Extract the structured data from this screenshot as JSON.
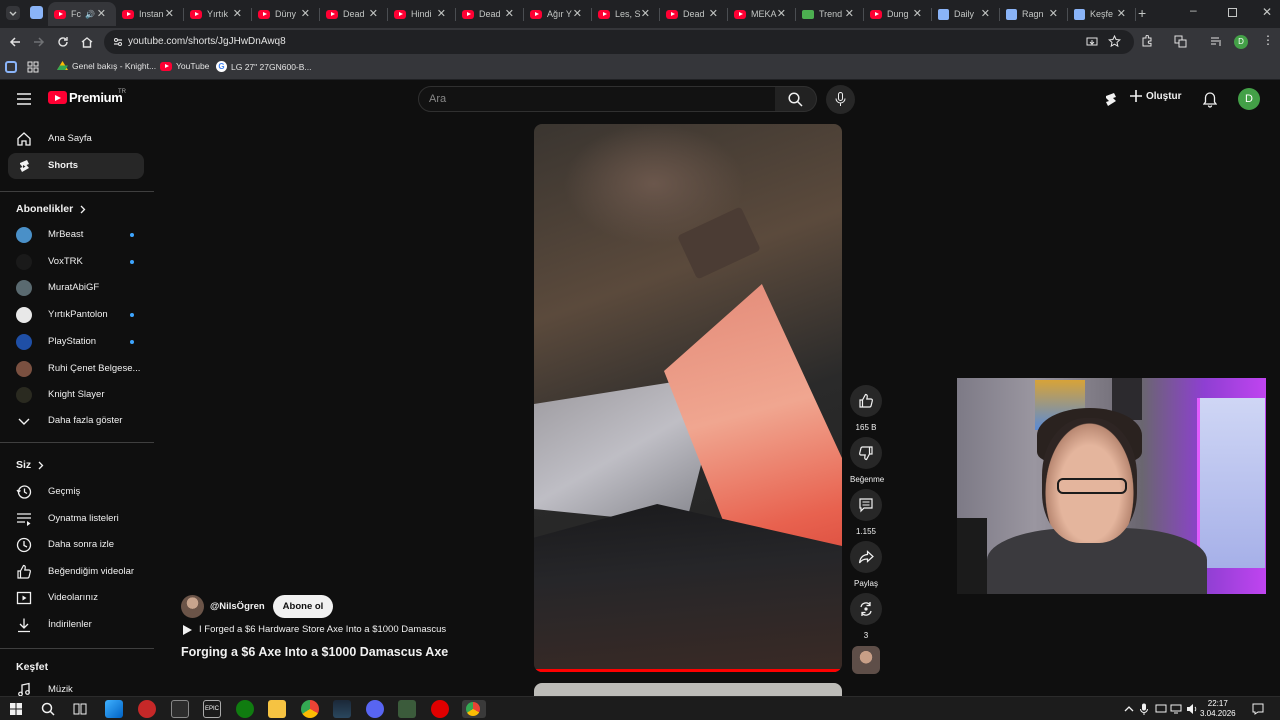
{
  "browser": {
    "tabs": [
      {
        "title": "Fc",
        "icon": "youtube",
        "active": true
      },
      {
        "title": "Instan",
        "icon": "youtube"
      },
      {
        "title": "Yırtık",
        "icon": "youtube"
      },
      {
        "title": "Düny",
        "icon": "youtube"
      },
      {
        "title": "Dead",
        "icon": "youtube"
      },
      {
        "title": "Hindi",
        "icon": "youtube"
      },
      {
        "title": "Dead",
        "icon": "youtube"
      },
      {
        "title": "Ağır Y",
        "icon": "youtube"
      },
      {
        "title": "Les, S",
        "icon": "youtube"
      },
      {
        "title": "Dead",
        "icon": "youtube"
      },
      {
        "title": "MEKA",
        "icon": "youtube"
      },
      {
        "title": "Trend",
        "icon": "trend"
      },
      {
        "title": "Dung",
        "icon": "youtube"
      },
      {
        "title": "Daily",
        "icon": "puzzle"
      },
      {
        "title": "Ragn",
        "icon": "puzzle"
      },
      {
        "title": "Keşfe",
        "icon": "puzzle"
      }
    ],
    "url": "youtube.com/shorts/JgJHwDnAwq8",
    "bookmarks": [
      {
        "label": "Genel bakış - Knight..."
      },
      {
        "label": "YouTube"
      },
      {
        "label": "LG 27\" 27GN600-B..."
      }
    ],
    "profile_initial": "D"
  },
  "header": {
    "logo_text": "Premium",
    "country": "TR",
    "search_placeholder": "Ara",
    "create_label": "Oluştur",
    "avatar_initial": "D"
  },
  "sidebar": {
    "main": [
      {
        "label": "Ana Sayfa",
        "icon": "home-icon"
      },
      {
        "label": "Shorts",
        "icon": "shorts-icon",
        "active": true
      }
    ],
    "subscriptions_heading": "Abonelikler",
    "subscriptions": [
      {
        "label": "MrBeast",
        "new": true,
        "color": "#4a90c8"
      },
      {
        "label": "VoxTRK",
        "new": true,
        "color": "#1a1a1a"
      },
      {
        "label": "MuratAbiGF",
        "new": false,
        "color": "#5a6a70"
      },
      {
        "label": "YırtıkPantolon",
        "new": true,
        "color": "#e8e8e8"
      },
      {
        "label": "PlayStation",
        "new": true,
        "color": "#1f4fa6"
      },
      {
        "label": "Ruhi Çenet Belgese...",
        "new": false,
        "color": "#7a5040"
      },
      {
        "label": "Knight Slayer",
        "new": false,
        "color": "#2a2a20"
      }
    ],
    "show_more": "Daha fazla göster",
    "you_heading": "Siz",
    "you": [
      {
        "label": "Geçmiş",
        "icon": "history-icon"
      },
      {
        "label": "Oynatma listeleri",
        "icon": "playlists-icon"
      },
      {
        "label": "Daha sonra izle",
        "icon": "watch-later-icon"
      },
      {
        "label": "Beğendiğim videolar",
        "icon": "liked-icon"
      },
      {
        "label": "Videolarınız",
        "icon": "your-videos-icon"
      },
      {
        "label": "İndirilenler",
        "icon": "downloads-icon"
      }
    ],
    "explore_heading": "Keşfet",
    "explore": [
      {
        "label": "Müzik",
        "icon": "music-icon"
      }
    ]
  },
  "short": {
    "author": "@NilsÖgren",
    "subscribe_label": "Abone ol",
    "linked_video": "I Forged a $6 Hardware Store Axe Into a $1000 Damascus",
    "title": "Forging a $6 Axe Into a $1000 Damascus Axe",
    "progress": 1.0,
    "actions": {
      "likes": "165 B",
      "dislike_label": "Beğenme",
      "comments": "1.155",
      "share_label": "Paylaş",
      "remix_count": "3"
    }
  },
  "taskbar": {
    "time": "22:17",
    "date": "3.04.2026"
  }
}
